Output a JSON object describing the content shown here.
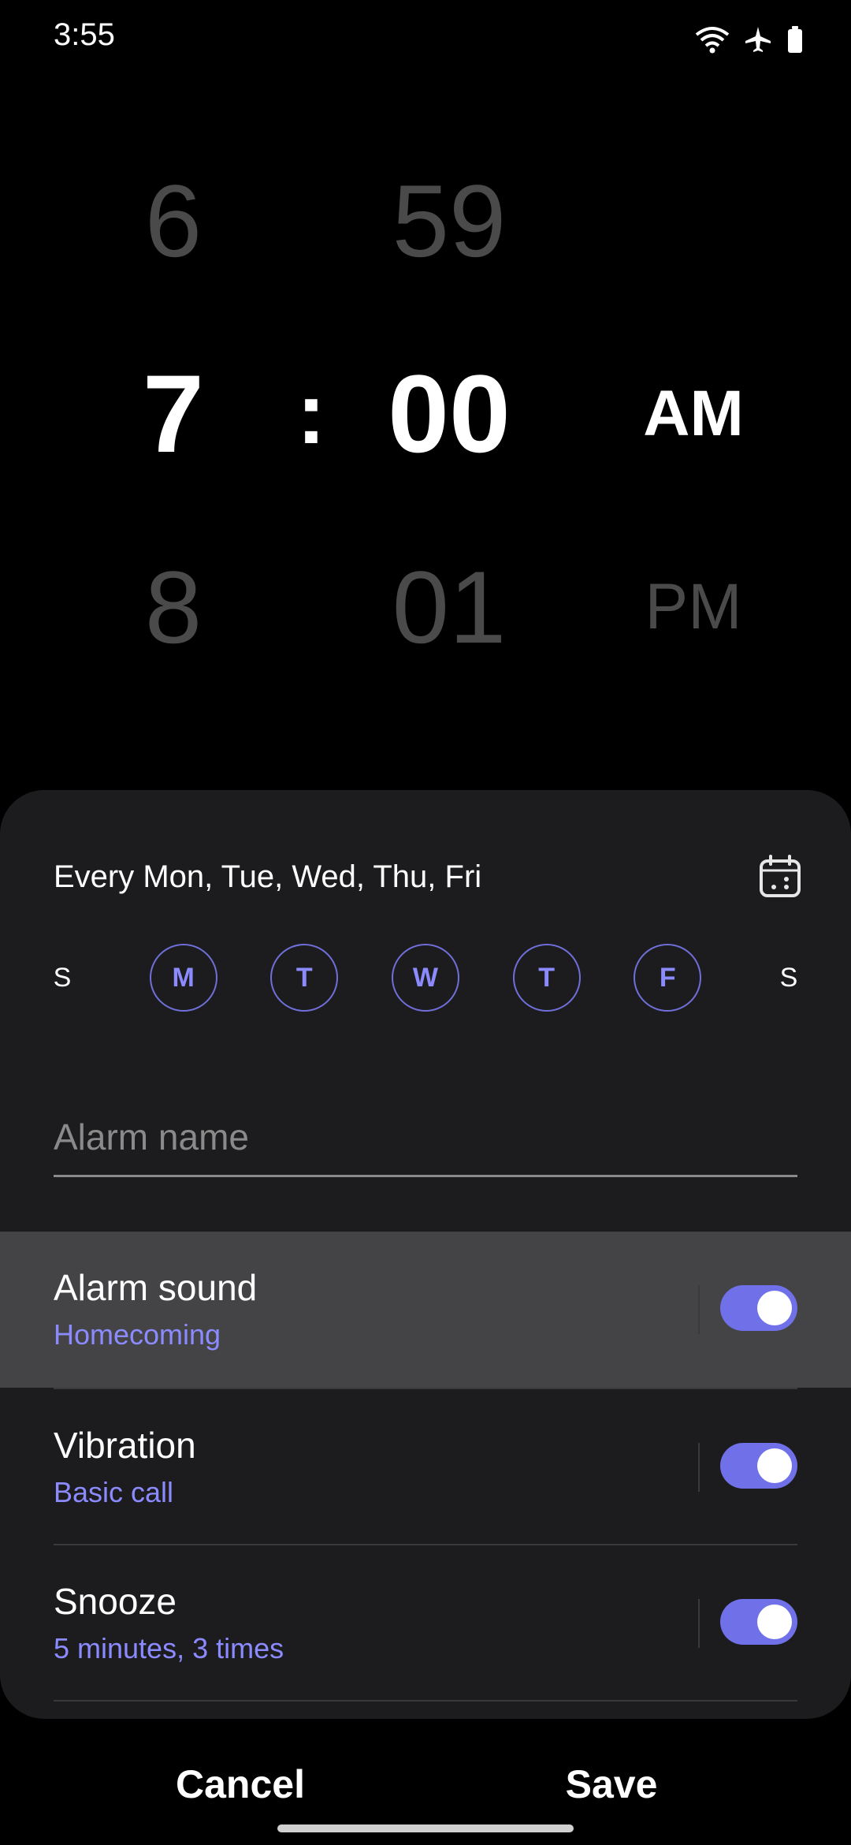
{
  "status_bar": {
    "time": "3:55",
    "icons": [
      "wifi-6-icon",
      "airplane-icon",
      "battery-icon"
    ]
  },
  "picker": {
    "hour_prev": "6",
    "hour_current": "7",
    "hour_next": "8",
    "separator": ":",
    "minute_prev": "59",
    "minute_current": "00",
    "minute_next": "01",
    "ampm_current": "AM",
    "ampm_next": "PM"
  },
  "repeat": {
    "summary": "Every Mon, Tue, Wed, Thu, Fri",
    "calendar_icon": "calendar-icon",
    "days": [
      {
        "label": "S",
        "selected": false
      },
      {
        "label": "M",
        "selected": true
      },
      {
        "label": "T",
        "selected": true
      },
      {
        "label": "W",
        "selected": true
      },
      {
        "label": "T",
        "selected": true
      },
      {
        "label": "F",
        "selected": true
      },
      {
        "label": "S",
        "selected": false
      }
    ]
  },
  "alarm_name": {
    "placeholder": "Alarm name",
    "value": ""
  },
  "settings": [
    {
      "title": "Alarm sound",
      "subtitle": "Homecoming",
      "enabled": true
    },
    {
      "title": "Vibration",
      "subtitle": "Basic call",
      "enabled": true
    },
    {
      "title": "Snooze",
      "subtitle": "5 minutes, 3 times",
      "enabled": true
    }
  ],
  "actions": {
    "cancel": "Cancel",
    "save": "Save"
  },
  "colors": {
    "accent": "#7070e8",
    "accent_text": "#8b8bff",
    "sheet_bg": "#1c1c1e",
    "highlight_row": "#444446"
  }
}
